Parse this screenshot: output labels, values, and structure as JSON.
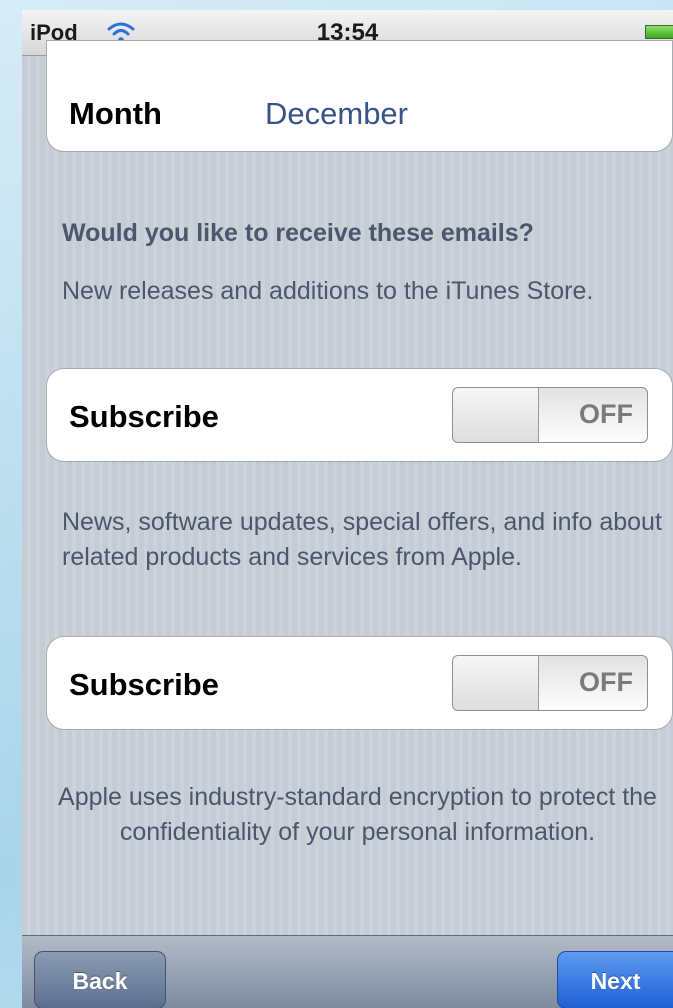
{
  "status_bar": {
    "carrier": "iPod",
    "time": "13:54"
  },
  "month_row": {
    "label": "Month",
    "value": "December"
  },
  "email_question": "Would you like to receive these emails?",
  "itunes_subscription": {
    "description": "New releases and additions to the iTunes Store.",
    "label": "Subscribe",
    "toggle_state": "OFF"
  },
  "apple_subscription": {
    "description": "News, software updates, special offers, and info about related products and services from Apple.",
    "label": "Subscribe",
    "toggle_state": "OFF"
  },
  "encryption_note": "Apple uses industry-standard encryption to protect the confidentiality of your personal information.",
  "toolbar": {
    "back_label": "Back",
    "next_label": "Next"
  },
  "colors": {
    "value_text": "#385487",
    "next_button": "#2f6fe0",
    "back_button": "#6f819e",
    "background_stripes": "#c5ccd4"
  },
  "icons": {
    "wifi": "wifi-icon",
    "battery": "battery-icon"
  }
}
